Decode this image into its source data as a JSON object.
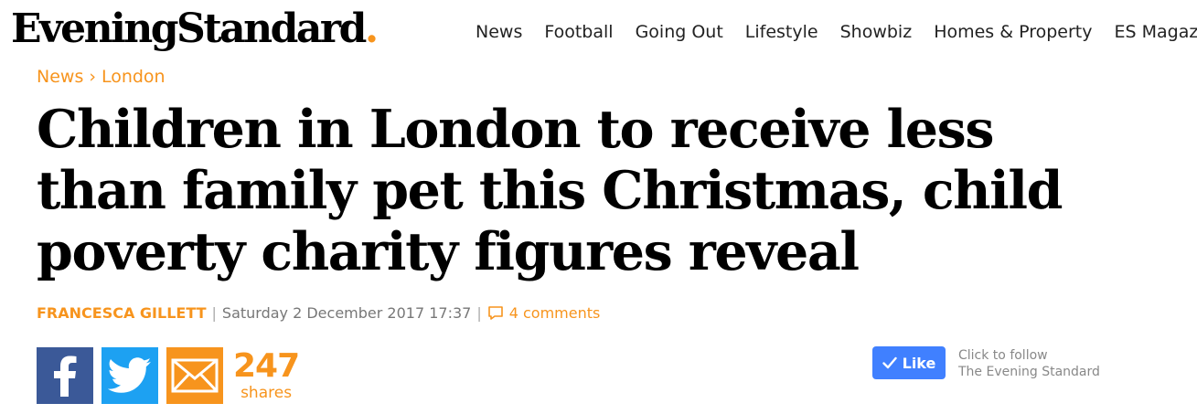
{
  "logo": {
    "text": "EveningStandard",
    "dot": "."
  },
  "nav": {
    "items": [
      "News",
      "Football",
      "Going Out",
      "Lifestyle",
      "Showbiz",
      "Homes & Property",
      "ES Magazine"
    ]
  },
  "breadcrumb": {
    "section": "News",
    "separator": "›",
    "subsection": "London"
  },
  "article": {
    "headline": "Children in London to receive less than family pet this Christmas, child poverty charity figures reveal",
    "author": "FRANCESCA GILLETT",
    "date": "Saturday 2 December 2017 17:37",
    "comments": "4 comments"
  },
  "share": {
    "facebook_icon": "facebook-icon",
    "twitter_icon": "twitter-icon",
    "email_icon": "email-icon",
    "count": "247",
    "count_label": "shares"
  },
  "like": {
    "label": "Like",
    "follow_line1": "Click to follow",
    "follow_line2": "The Evening Standard"
  },
  "colors": {
    "accent": "#f7941d",
    "facebook": "#3b5998",
    "twitter": "#1da1f2",
    "like_button": "#4080ff"
  }
}
